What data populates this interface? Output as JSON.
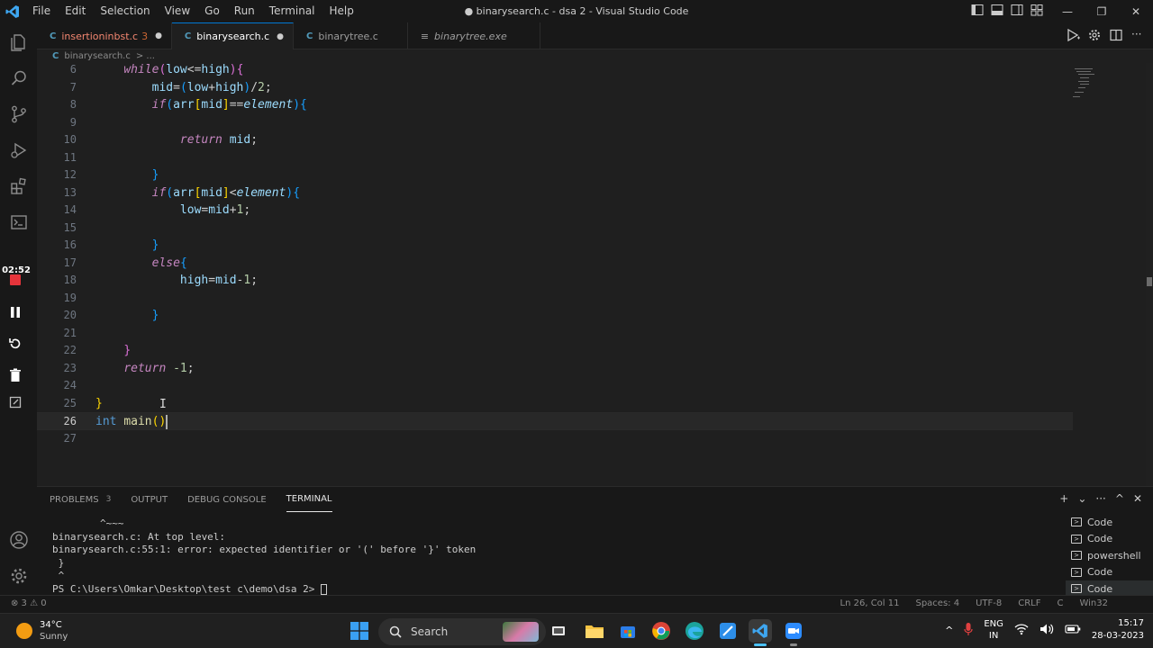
{
  "menu": [
    "File",
    "Edit",
    "Selection",
    "View",
    "Go",
    "Run",
    "Terminal",
    "Help"
  ],
  "window_title": "● binarysearch.c - dsa 2 - Visual Studio Code",
  "recording": {
    "timer": "02:52"
  },
  "tabs": [
    {
      "name": "insertioninbst.c",
      "badge": "3",
      "modified": "●",
      "active": false,
      "color": "#f48771"
    },
    {
      "name": "binarysearch.c",
      "badge": "",
      "modified": "●",
      "active": true,
      "color": "#ffffff"
    },
    {
      "name": "binarytree.c",
      "badge": "",
      "modified": "",
      "active": false,
      "color": "#9d9d9d"
    },
    {
      "name": "binarytree.exe",
      "badge": "",
      "modified": "",
      "active": false,
      "color": "#9d9d9d"
    }
  ],
  "c_icon": "C",
  "breadcrumb": {
    "file": "binarysearch.c",
    "sep": "> ..."
  },
  "editor": {
    "current_line": "26",
    "lines": [
      {
        "n": "6"
      },
      {
        "n": "7"
      },
      {
        "n": "8"
      },
      {
        "n": "9"
      },
      {
        "n": "10"
      },
      {
        "n": "11"
      },
      {
        "n": "12"
      },
      {
        "n": "13"
      },
      {
        "n": "14"
      },
      {
        "n": "15"
      },
      {
        "n": "16"
      },
      {
        "n": "17"
      },
      {
        "n": "18"
      },
      {
        "n": "19"
      },
      {
        "n": "20"
      },
      {
        "n": "21"
      },
      {
        "n": "22"
      },
      {
        "n": "23"
      },
      {
        "n": "24"
      },
      {
        "n": "25"
      },
      {
        "n": "26"
      },
      {
        "n": "27"
      }
    ]
  },
  "code_tokens": {
    "while": "while",
    "low": "low",
    "le": "<=",
    "high": "high",
    "lp": "(",
    "rp": ")",
    "lb": "{",
    "rb": "}",
    "mid": "mid",
    "eq": "=",
    "plus": "+",
    "div": "/",
    "two": "2",
    "semi": ";",
    "if": "if",
    "arr": "arr",
    "lsq": "[",
    "rsq": "]",
    "eqeq": "==",
    "element": "element",
    "return": "return",
    "lt": "<",
    "one": "1",
    "minus": "-",
    "else": "else",
    "neg1": "-1",
    "int": "int",
    "main": "main"
  },
  "panel": {
    "tabs": [
      {
        "label": "PROBLEMS",
        "badge": "3",
        "active": false
      },
      {
        "label": "OUTPUT",
        "badge": "",
        "active": false
      },
      {
        "label": "DEBUG CONSOLE",
        "badge": "",
        "active": false
      },
      {
        "label": "TERMINAL",
        "badge": "",
        "active": true
      }
    ],
    "actions": [
      "+",
      "⌄",
      "···",
      "^",
      "✕"
    ],
    "terminal_lines": [
      "        ^~~~",
      "binarysearch.c: At top level:",
      "binarysearch.c:55:1: error: expected identifier or '(' before '}' token",
      " }",
      " ^",
      "PS C:\\Users\\Omkar\\Desktop\\test c\\demo\\dsa 2> "
    ],
    "terminals": [
      {
        "label": "Code",
        "selected": false
      },
      {
        "label": "Code",
        "selected": false
      },
      {
        "label": "powershell",
        "selected": false
      },
      {
        "label": "Code",
        "selected": false
      },
      {
        "label": "Code",
        "selected": true
      }
    ]
  },
  "status": {
    "problems": "⊗ 3 ⚠ 0",
    "position": "Ln 26, Col 11",
    "spaces": "Spaces: 4",
    "encoding": "UTF-8",
    "eol": "CRLF",
    "lang": "C",
    "platform": "Win32"
  },
  "taskbar": {
    "temp": "34°C",
    "weather": "Sunny",
    "search_placeholder": "Search",
    "lang_top": "ENG",
    "lang_bottom": "IN",
    "time": "15:17",
    "date": "28-03-2023"
  }
}
